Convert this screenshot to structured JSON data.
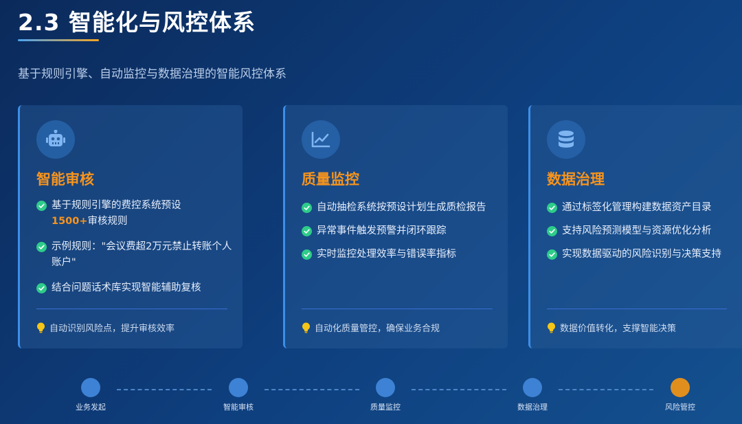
{
  "header": {
    "title": "2.3 智能化与风控体系",
    "subtitle": "基于规则引擎、自动监控与数据治理的智能风控体系"
  },
  "cards": [
    {
      "icon": "robot-icon",
      "title": "智能审核",
      "items": [
        {
          "text": "基于规则引擎的费控系统预设",
          "highlight": "1500+",
          "text_after": "审核规则"
        },
        {
          "text": "示例规则：\"会议费超2万元禁止转账个人账户\""
        },
        {
          "text": "结合问题话术库实现智能辅助复核"
        }
      ],
      "footer": "自动识别风险点，提升审核效率"
    },
    {
      "icon": "chart-line-icon",
      "title": "质量监控",
      "items": [
        {
          "text": "自动抽检系统按预设计划生成质检报告"
        },
        {
          "text": "异常事件触发预警并闭环跟踪"
        },
        {
          "text": "实时监控处理效率与错误率指标"
        }
      ],
      "footer": "自动化质量管控，确保业务合规"
    },
    {
      "icon": "database-icon",
      "title": "数据治理",
      "items": [
        {
          "text": "通过标签化管理构建数据资产目录"
        },
        {
          "text": "支持风险预测模型与资源优化分析"
        },
        {
          "text": "实现数据驱动的风险识别与决策支持"
        }
      ],
      "footer": "数据价值转化，支撑智能决策"
    }
  ],
  "flow": {
    "steps": [
      {
        "label": "业务发起"
      },
      {
        "label": "智能审核"
      },
      {
        "label": "质量监控"
      },
      {
        "label": "数据治理"
      },
      {
        "label": "风险管控"
      }
    ]
  },
  "colors": {
    "accent_orange": "#f7941d",
    "accent_blue": "#3d8fe8",
    "check_green": "#2ecc8a",
    "bulb_yellow": "#f5c518"
  }
}
